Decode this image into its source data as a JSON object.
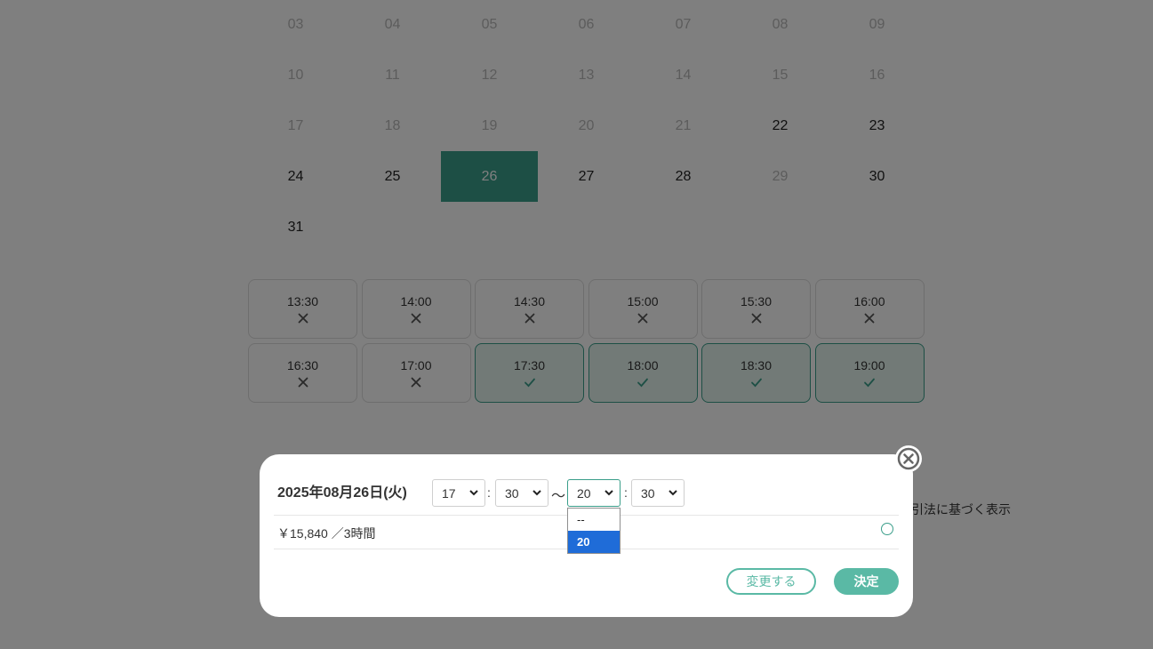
{
  "calendar": {
    "rows": [
      [
        {
          "d": "03",
          "m": 1
        },
        {
          "d": "04",
          "m": 1
        },
        {
          "d": "05",
          "m": 1
        },
        {
          "d": "06",
          "m": 1
        },
        {
          "d": "07",
          "m": 1
        },
        {
          "d": "08",
          "m": 1
        },
        {
          "d": "09",
          "m": 1
        }
      ],
      [
        {
          "d": "10",
          "m": 1
        },
        {
          "d": "11",
          "m": 1
        },
        {
          "d": "12",
          "m": 1
        },
        {
          "d": "13",
          "m": 1
        },
        {
          "d": "14",
          "m": 1
        },
        {
          "d": "15",
          "m": 1
        },
        {
          "d": "16",
          "m": 1
        }
      ],
      [
        {
          "d": "17",
          "m": 1
        },
        {
          "d": "18",
          "m": 1
        },
        {
          "d": "19",
          "m": 1
        },
        {
          "d": "20",
          "m": 1
        },
        {
          "d": "21",
          "m": 1
        },
        {
          "d": "22",
          "m": 0
        },
        {
          "d": "23",
          "m": 0
        }
      ],
      [
        {
          "d": "24",
          "m": 0
        },
        {
          "d": "25",
          "m": 0
        },
        {
          "d": "26",
          "m": 0,
          "s": 1
        },
        {
          "d": "27",
          "m": 0
        },
        {
          "d": "28",
          "m": 0
        },
        {
          "d": "29",
          "m": 1
        },
        {
          "d": "30",
          "m": 0
        }
      ],
      [
        {
          "d": "31",
          "m": 0
        }
      ]
    ]
  },
  "slots": [
    {
      "time": "13:30",
      "status": "unavailable"
    },
    {
      "time": "14:00",
      "status": "unavailable"
    },
    {
      "time": "14:30",
      "status": "unavailable"
    },
    {
      "time": "15:00",
      "status": "unavailable"
    },
    {
      "time": "15:30",
      "status": "unavailable"
    },
    {
      "time": "16:00",
      "status": "unavailable"
    },
    {
      "time": "16:30",
      "status": "unavailable"
    },
    {
      "time": "17:00",
      "status": "unavailable"
    },
    {
      "time": "17:30",
      "status": "selected"
    },
    {
      "time": "18:00",
      "status": "selected"
    },
    {
      "time": "18:30",
      "status": "selected"
    },
    {
      "time": "19:00",
      "status": "selected"
    }
  ],
  "background_note": "引法に基づく表示",
  "modal": {
    "date": "2025年08月26日(火)",
    "start_hour": "17",
    "start_minute": "30",
    "range_sep": "〜",
    "colon": ":",
    "end_hour": "20",
    "end_minute": "30",
    "price": "￥15,840 ／3時間",
    "change_label": "変更する",
    "confirm_label": "決定"
  },
  "dropdown": {
    "options": [
      "--",
      "20"
    ],
    "highlighted": "20"
  },
  "colors": {
    "accent": "#3a9e8a",
    "button": "#5ab9a5",
    "highlight": "#1f6cd8",
    "overlay": "rgba(0,0,0,0.5)"
  }
}
